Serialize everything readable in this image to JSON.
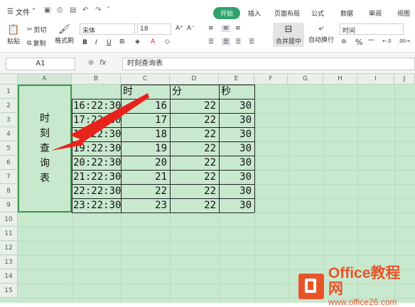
{
  "menubar": {
    "file": "文件",
    "tabs": [
      "开始",
      "插入",
      "页面布局",
      "公式",
      "数据",
      "审阅",
      "视图"
    ]
  },
  "ribbon": {
    "paste": "粘贴",
    "cut": "剪切",
    "copy": "复制",
    "format_painter": "格式刷",
    "font": "宋体",
    "font_size": "18",
    "bold": "B",
    "italic": "I",
    "underline": "U",
    "merge": "合并居中",
    "wrap": "自动换行",
    "number_format": "时间",
    "percent": "%"
  },
  "formula_bar": {
    "name_box": "A1",
    "fx": "fx",
    "content": "时刻查询表"
  },
  "columns": [
    "A",
    "B",
    "C",
    "D",
    "E",
    "F",
    "G",
    "H",
    "I",
    "J"
  ],
  "rows": [
    "1",
    "2",
    "3",
    "4",
    "5",
    "6",
    "7",
    "8",
    "9",
    "10",
    "11",
    "12",
    "13",
    "14",
    "15"
  ],
  "merged_label": [
    "时",
    "刻",
    "查",
    "询",
    "表"
  ],
  "header_row": {
    "c": "时",
    "d": "分",
    "e": "秒"
  },
  "table": [
    {
      "time": "16:22:30",
      "h": "16",
      "m": "22",
      "s": "30"
    },
    {
      "time": "17:22:30",
      "h": "17",
      "m": "22",
      "s": "30"
    },
    {
      "time": "18:22:30",
      "h": "18",
      "m": "22",
      "s": "30"
    },
    {
      "time": "19:22:30",
      "h": "19",
      "m": "22",
      "s": "30"
    },
    {
      "time": "20:22:30",
      "h": "20",
      "m": "22",
      "s": "30"
    },
    {
      "time": "21:22:30",
      "h": "21",
      "m": "22",
      "s": "30"
    },
    {
      "time": "22:22:30",
      "h": "22",
      "m": "22",
      "s": "30"
    },
    {
      "time": "23:22:30",
      "h": "23",
      "m": "22",
      "s": "30"
    }
  ],
  "watermark": {
    "brand": "Office教程网",
    "url": "www.office26.com"
  },
  "colors": {
    "accent": "#2fa36b",
    "sheet_bg": "#c9e9cf",
    "arrow": "#e8231c",
    "logo": "#e8542a"
  }
}
